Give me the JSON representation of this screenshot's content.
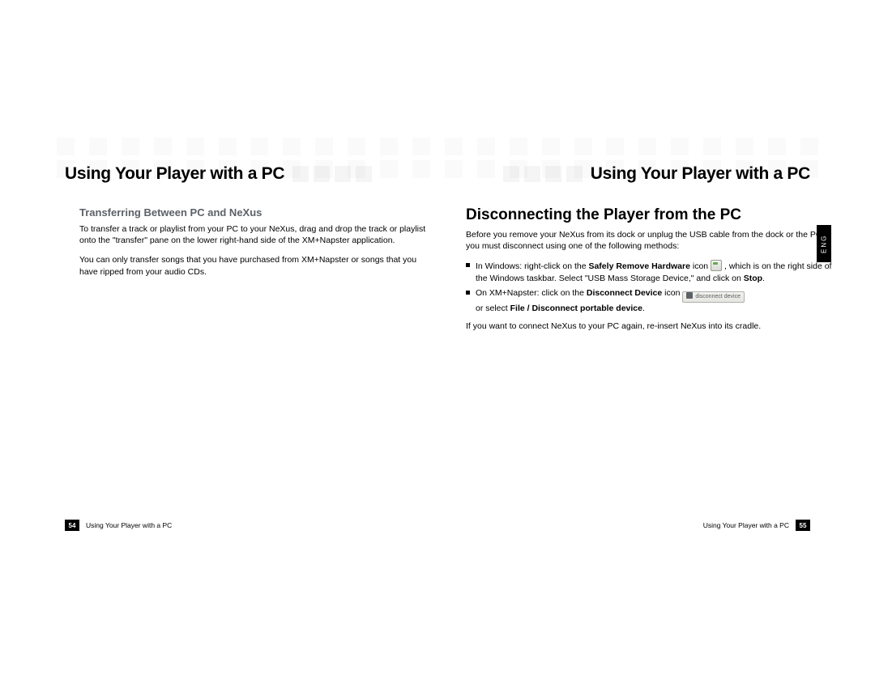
{
  "header": {
    "title_left": "Using Your Player with a PC",
    "title_right": "Using Your Player with a PC"
  },
  "left": {
    "subhead": "Transferring Between PC and NeXus",
    "p1": "To transfer a track or playlist from your PC to your NeXus, drag and drop the track or playlist onto the \"transfer\" pane on the lower right-hand side of the XM+Napster application.",
    "p2": "You can only transfer songs that you have purchased from XM+Napster or songs that you have ripped from your audio CDs."
  },
  "right": {
    "h2": "Disconnecting the Player from the PC",
    "intro": "Before you remove your NeXus from its dock or unplug the USB cable from the dock or the PC, you must disconnect using one of the following methods:",
    "li1_a": "In Windows: right-click on the ",
    "li1_b": "Safely Remove Hardware",
    "li1_c": " icon ",
    "li1_d": " , which is on the right side of the Windows taskbar. Select \"USB Mass Storage Device,\" and click on ",
    "li1_e": "Stop",
    "li1_f": ".",
    "li2_a": "On XM+Napster: click on the ",
    "li2_b": "Disconnect Device",
    "li2_c": " icon ",
    "li2_btn": "disconnect device",
    "li2_d": " or select ",
    "li2_e": "File / Disconnect portable device",
    "li2_f": ".",
    "outro": "If you want to connect NeXus to your PC again, re-insert NeXus into its cradle."
  },
  "lang_tab": "ENG",
  "footer": {
    "left_num": "54",
    "left_text": "Using Your Player with a PC",
    "right_text": "Using Your Player with a PC",
    "right_num": "55"
  }
}
